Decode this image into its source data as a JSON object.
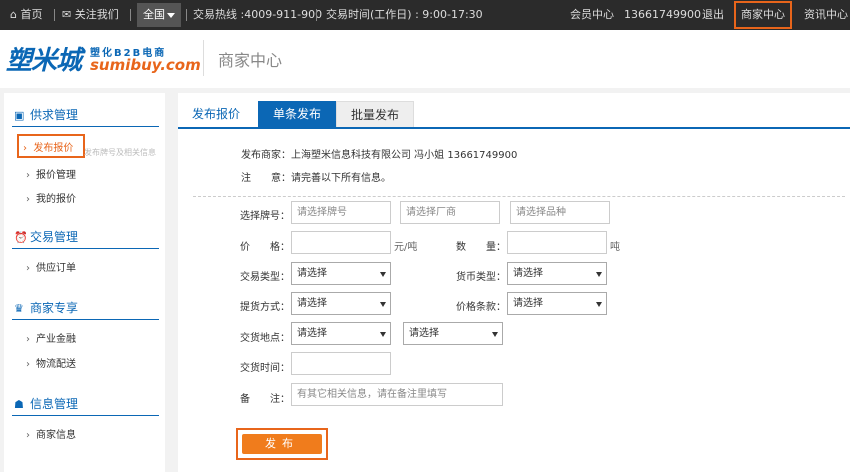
{
  "topbar": {
    "home": "首页",
    "follow": "关注我们",
    "region": "全国",
    "hotline": "交易热线 :4009-911-900",
    "hours": "交易时间(工作日) : 9:00-17:30",
    "member_center": "会员中心",
    "phone": "13661749900",
    "logout": "退出",
    "merchant_center": "商家中心",
    "news_center": "资讯中心"
  },
  "header": {
    "logo_cn": "塑米城",
    "logo_tag": "塑化B2B电商",
    "logo_en": "sumibuy.com",
    "title": "商家中心"
  },
  "sidebar": {
    "sections": [
      {
        "title": "供求管理",
        "icon": "box-icon",
        "items": [
          "发布报价",
          "报价管理",
          "我的报价"
        ]
      },
      {
        "title": "交易管理",
        "icon": "alarm-icon",
        "items": [
          "供应订单"
        ]
      },
      {
        "title": "商家专享",
        "icon": "crown-icon",
        "items": [
          "产业金融",
          "物流配送"
        ]
      },
      {
        "title": "信息管理",
        "icon": "users-icon",
        "items": [
          "商家信息"
        ]
      }
    ],
    "active_hint": "发布牌号及相关信息"
  },
  "main": {
    "section_title": "发布报价",
    "tabs": [
      "单条发布",
      "批量发布"
    ],
    "merchant_label": "发布商家：上海塑米信息科技有限公司 冯小姐 13661749900",
    "notice_label": "注　　意：请完善以下所有信息。",
    "form": {
      "brand_label": "选择牌号：",
      "brand_placeholder": "请选择牌号",
      "factory_placeholder": "请选择厂商",
      "variety_placeholder": "请选择品种",
      "price_label": "价　　格：",
      "price_unit": "元/吨",
      "qty_label": "数　　量：",
      "qty_unit": "吨",
      "trade_type_label": "交易类型：",
      "trade_type_value": "请选择",
      "currency_label": "货币类型：",
      "currency_value": "请选择",
      "pickup_label": "提货方式：",
      "pickup_value": "请选择",
      "price_terms_label": "价格条款：",
      "price_terms_value": "请选择",
      "delivery_place_label": "交货地点：",
      "delivery_place_value1": "请选择",
      "delivery_place_value2": "请选择",
      "delivery_time_label": "交货时间：",
      "remark_label": "备　　注：",
      "remark_placeholder": "有其它相关信息，请在备注里填写",
      "publish": "发布"
    }
  }
}
